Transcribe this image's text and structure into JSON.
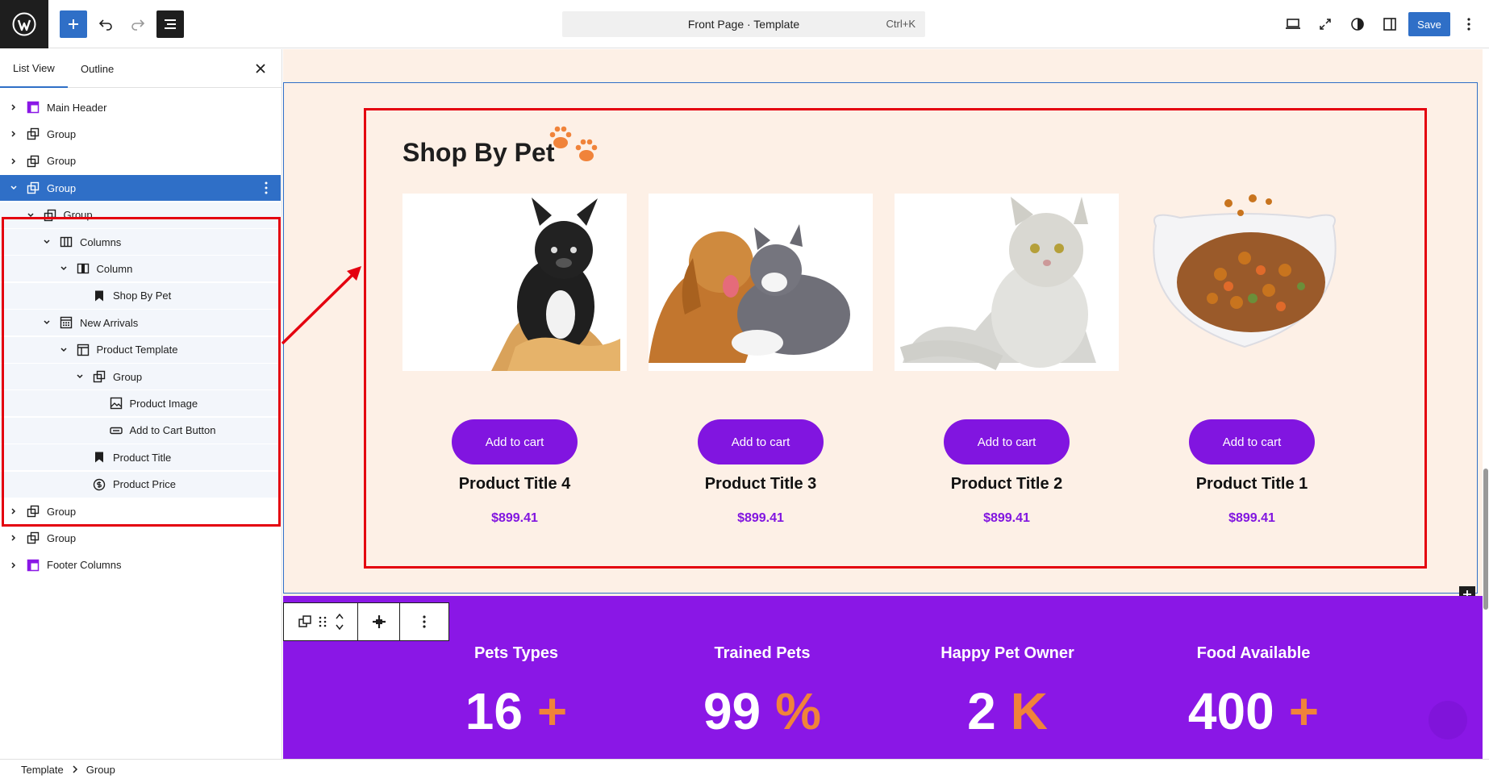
{
  "topbar": {
    "command_label": "Front Page · Template",
    "command_shortcut": "Ctrl+K",
    "save_label": "Save"
  },
  "sidebar": {
    "tabs": [
      "List View",
      "Outline"
    ],
    "tree": [
      {
        "label": "Main Header",
        "icon": "template-part-icon"
      },
      {
        "label": "Group",
        "icon": "group-icon"
      },
      {
        "label": "Group",
        "icon": "group-icon"
      },
      {
        "label": "Group",
        "icon": "group-icon",
        "selected": true
      },
      {
        "label": "Group",
        "icon": "group-icon"
      },
      {
        "label": "Columns",
        "icon": "columns-icon"
      },
      {
        "label": "Column",
        "icon": "column-icon"
      },
      {
        "label": "Shop By Pet",
        "icon": "bookmark-icon"
      },
      {
        "label": "New Arrivals",
        "icon": "query-loop-icon"
      },
      {
        "label": "Product Template",
        "icon": "product-template-icon"
      },
      {
        "label": "Group",
        "icon": "group-icon"
      },
      {
        "label": "Product Image",
        "icon": "image-icon"
      },
      {
        "label": "Add to Cart Button",
        "icon": "button-icon"
      },
      {
        "label": "Product Title",
        "icon": "bookmark-icon"
      },
      {
        "label": "Product Price",
        "icon": "dollar-icon"
      },
      {
        "label": "Group",
        "icon": "group-icon"
      },
      {
        "label": "Group",
        "icon": "group-icon"
      },
      {
        "label": "Footer Columns",
        "icon": "template-part-icon"
      }
    ]
  },
  "canvas": {
    "section_title": "Shop By Pet",
    "products": [
      {
        "button": "Add to cart",
        "title": "Product Title 4",
        "price": "$899.41",
        "image": "french-bulldog"
      },
      {
        "button": "Add to cart",
        "title": "Product Title 3",
        "price": "$899.41",
        "image": "dog-and-cat"
      },
      {
        "button": "Add to cart",
        "title": "Product Title 2",
        "price": "$899.41",
        "image": "fluffy-cat"
      },
      {
        "button": "Add to cart",
        "title": "Product Title 1",
        "price": "$899.41",
        "image": "pet-food-bowl"
      }
    ],
    "stats": [
      {
        "label": "Pets Types",
        "value": "16",
        "suffix": "+"
      },
      {
        "label": "Trained Pets",
        "value": "99",
        "suffix": "%"
      },
      {
        "label": "Happy Pet Owner",
        "value": "2",
        "suffix": "K"
      },
      {
        "label": "Food Available",
        "value": "400",
        "suffix": "+"
      }
    ]
  },
  "footer": {
    "breadcrumb": [
      "Template",
      "Group"
    ]
  },
  "colors": {
    "accent": "#2f6fc7",
    "purple": "#8115e0",
    "orange": "#f0833a",
    "highlight_red": "#e4000f",
    "canvas_bg": "#fdf0e6"
  }
}
